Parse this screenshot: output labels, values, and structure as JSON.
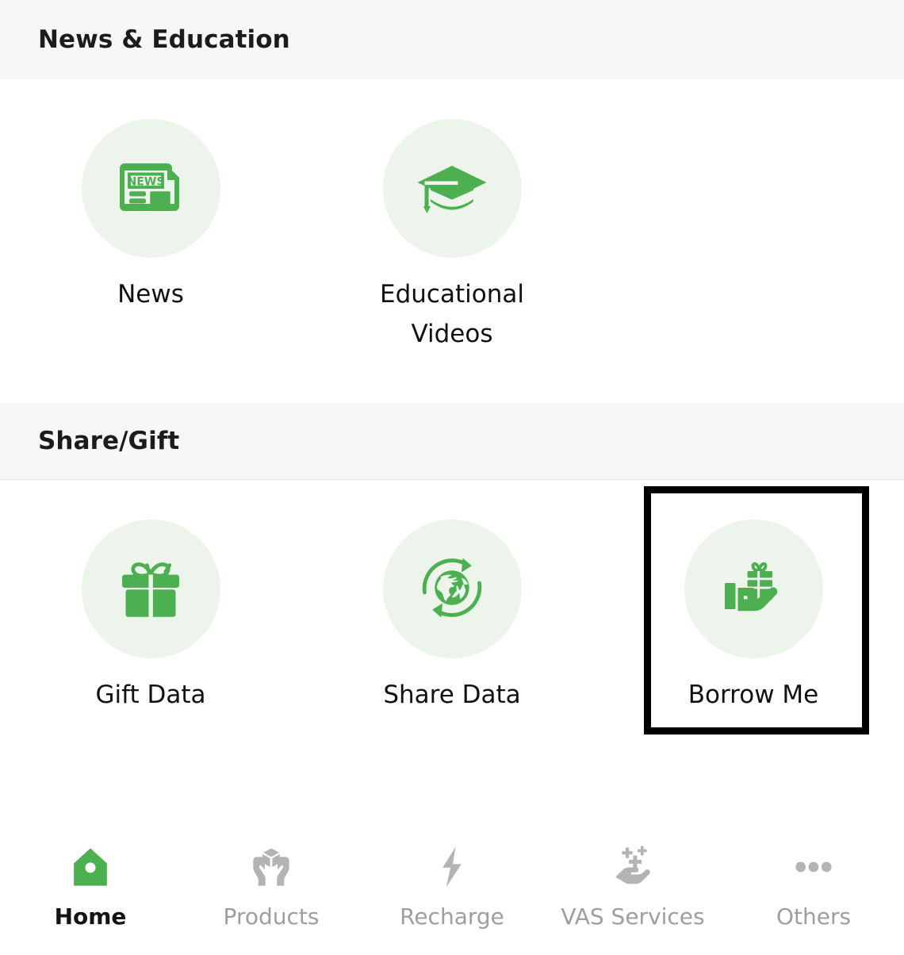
{
  "colors": {
    "brand_green": "#4CAF50",
    "icon_circle_bg": "#ECF4EC",
    "section_band_bg": "#F7F7F7",
    "nav_inactive": "#9E9E9E",
    "nav_active": "#141414",
    "selection_border": "#000000"
  },
  "sections": [
    {
      "title": "News & Education",
      "tiles": [
        {
          "label": "News",
          "icon": "newspaper-icon",
          "selected": false
        },
        {
          "label": "Educational Videos",
          "icon": "graduation-cap-icon",
          "selected": false
        }
      ]
    },
    {
      "title": "Share/Gift",
      "tiles": [
        {
          "label": "Gift Data",
          "icon": "gift-box-icon",
          "selected": false
        },
        {
          "label": "Share Data",
          "icon": "globe-refresh-icon",
          "selected": false
        },
        {
          "label": "Borrow Me",
          "icon": "hand-holding-gift-icon",
          "selected": true
        }
      ]
    }
  ],
  "bottom_nav": {
    "items": [
      {
        "label": "Home",
        "icon": "home-icon",
        "active": true
      },
      {
        "label": "Products",
        "icon": "hands-holding-box-icon",
        "active": false
      },
      {
        "label": "Recharge",
        "icon": "lightning-bolt-icon",
        "active": false
      },
      {
        "label": "VAS Services",
        "icon": "hand-sparkles-icon",
        "active": false
      },
      {
        "label": "Others",
        "icon": "three-dots-icon",
        "active": false
      }
    ]
  }
}
